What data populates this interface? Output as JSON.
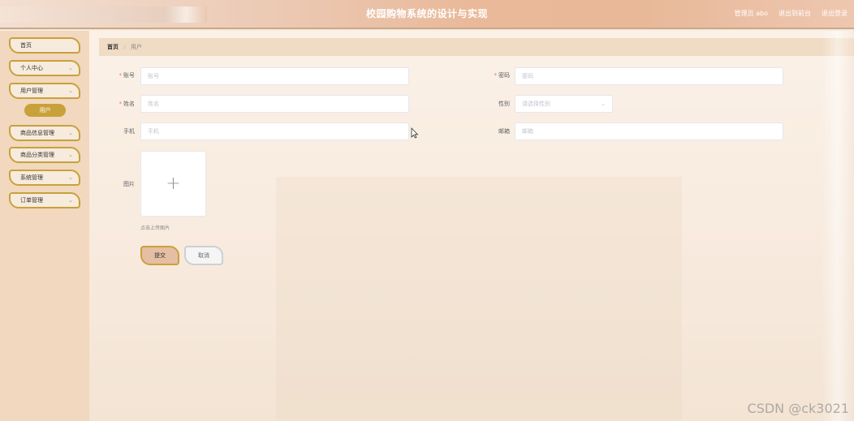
{
  "header": {
    "title": "校园购物系统的设计与实现",
    "user_label": "管理员 abo",
    "back_label": "退出到前台",
    "logout_label": "退出登录"
  },
  "sidebar": {
    "items": [
      {
        "label": "首页"
      },
      {
        "label": "个人中心"
      },
      {
        "label": "用户管理"
      },
      {
        "label": "商品信息管理"
      },
      {
        "label": "商品分类管理"
      },
      {
        "label": "系统管理"
      },
      {
        "label": "订单管理"
      }
    ],
    "sub_item": "用户"
  },
  "breadcrumb": {
    "home": "首页",
    "separator": "/",
    "current": "用户"
  },
  "form": {
    "account_label": "账号",
    "account_placeholder": "账号",
    "password_label": "密码",
    "password_placeholder": "密码",
    "name_label": "姓名",
    "name_placeholder": "姓名",
    "gender_label": "性别",
    "gender_placeholder": "请选择性别",
    "phone_label": "手机",
    "phone_placeholder": "手机",
    "email_label": "邮箱",
    "email_placeholder": "邮箱",
    "image_label": "图片",
    "upload_tip": "点击上传图片",
    "required_mark": "*",
    "submit_label": "提交",
    "cancel_label": "取消"
  },
  "watermark": "CSDN @ck3021",
  "colors": {
    "accent": "#c9a13a",
    "required": "#f56c6c",
    "sidebar_bg": "#f1d8bf"
  }
}
